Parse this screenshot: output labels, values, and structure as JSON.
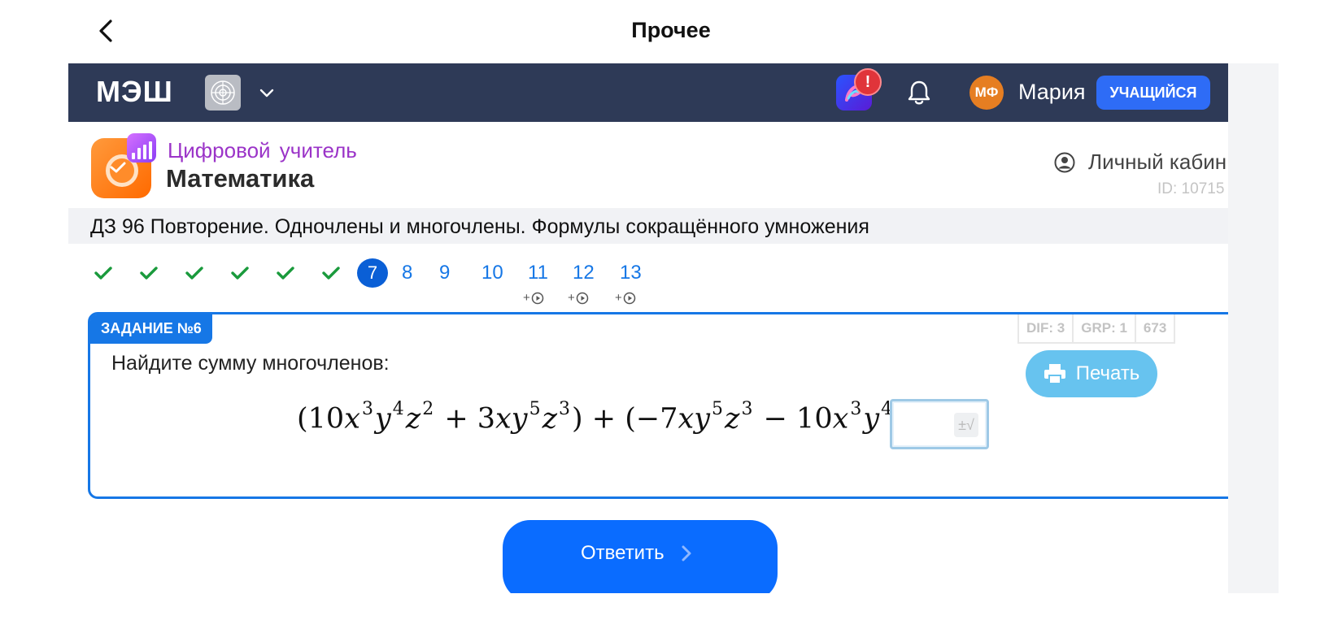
{
  "topbar": {
    "title": "Прочее"
  },
  "navbar": {
    "logo": "МЭШ",
    "alert_badge": "!",
    "user_initials": "МФ",
    "user_name": "Мария",
    "role_badge": "УЧАЩИЙСЯ"
  },
  "brand": {
    "subtitle": "Цифровой учитель",
    "title": "Математика",
    "cabinet_label": "Личный кабин",
    "user_id": "ID: 10715"
  },
  "task_header": {
    "title": "ДЗ 96 Повторение. Одночлены и многочлены. Формулы сокращённого умножения"
  },
  "steps": {
    "done_count": 6,
    "current": "7",
    "upcoming": [
      "8",
      "9",
      "10"
    ],
    "video": [
      {
        "label": "11",
        "mark": "+"
      },
      {
        "label": "12",
        "mark": "+"
      },
      {
        "label": "13",
        "mark": "+"
      }
    ]
  },
  "task": {
    "label": "ЗАДАНИЕ №6",
    "meta": [
      "DIF: 3",
      "GRP: 1",
      "673"
    ],
    "question": "Найдите сумму многочленов:",
    "print_label": "Печать"
  },
  "submit": {
    "label": "Ответить"
  },
  "colors": {
    "navbar": "#2e3a57",
    "accent_blue": "#1677e6",
    "done_green": "#1a9a3c",
    "brand_purple": "#9b34c8",
    "print_button": "#67c3ef"
  }
}
